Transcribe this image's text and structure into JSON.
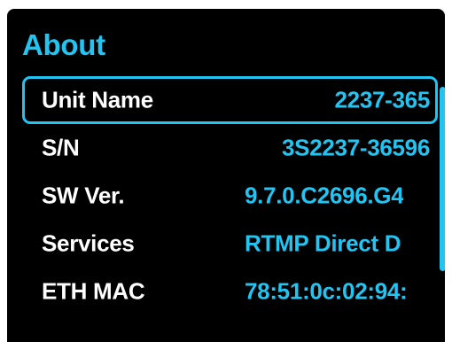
{
  "screen": {
    "title": "About",
    "accent_color": "#22c4f2",
    "text_color": "#ffffff",
    "background_color": "#000000"
  },
  "rows": [
    {
      "label": "Unit Name",
      "value": "2237-365",
      "selected": true
    },
    {
      "label": "S/N",
      "value": "3S2237-36596",
      "selected": false
    },
    {
      "label": "SW Ver.",
      "value": "9.7.0.C2696.G4",
      "selected": false
    },
    {
      "label": "Services",
      "value": "RTMP Direct D",
      "selected": false
    },
    {
      "label": "ETH MAC",
      "value": "78:51:0c:02:94:",
      "selected": false
    }
  ]
}
